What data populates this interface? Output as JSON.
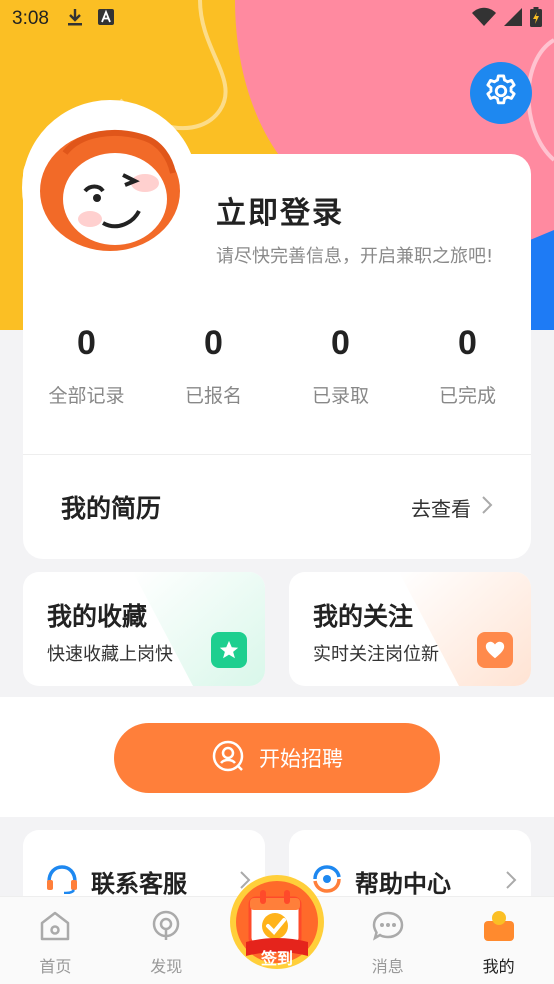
{
  "status_bar": {
    "time": "3:08"
  },
  "profile": {
    "title": "立即登录",
    "subtitle": "请尽快完善信息，开启兼职之旅吧!",
    "stats": [
      {
        "value": "0",
        "label": "全部记录"
      },
      {
        "value": "0",
        "label": "已报名"
      },
      {
        "value": "0",
        "label": "已录取"
      },
      {
        "value": "0",
        "label": "已完成"
      }
    ],
    "resume": {
      "title": "我的简历",
      "action": "去查看"
    }
  },
  "features": [
    {
      "title": "我的收藏",
      "subtitle": "快速收藏上岗快",
      "icon": "star-icon",
      "color": "#1ecf8f"
    },
    {
      "title": "我的关注",
      "subtitle": "实时关注岗位新",
      "icon": "heart-icon",
      "color": "#ff8a4c"
    }
  ],
  "recruit": {
    "label": "开始招聘"
  },
  "services": [
    {
      "label": "联系客服",
      "icon": "headset-icon"
    },
    {
      "label": "帮助中心",
      "icon": "help-icon"
    }
  ],
  "bottom_nav": [
    {
      "label": "首页",
      "icon": "home-icon",
      "active": false
    },
    {
      "label": "发现",
      "icon": "discover-icon",
      "active": false
    },
    {
      "label": "签到",
      "icon": "checkin-icon",
      "active": false
    },
    {
      "label": "消息",
      "icon": "message-icon",
      "active": false
    },
    {
      "label": "我的",
      "icon": "profile-icon",
      "active": true
    }
  ],
  "colors": {
    "accent": "#ff7f3a",
    "brand_blue": "#1e88f0",
    "yellow": "#fbbf24",
    "pink": "#ff8aa0"
  }
}
